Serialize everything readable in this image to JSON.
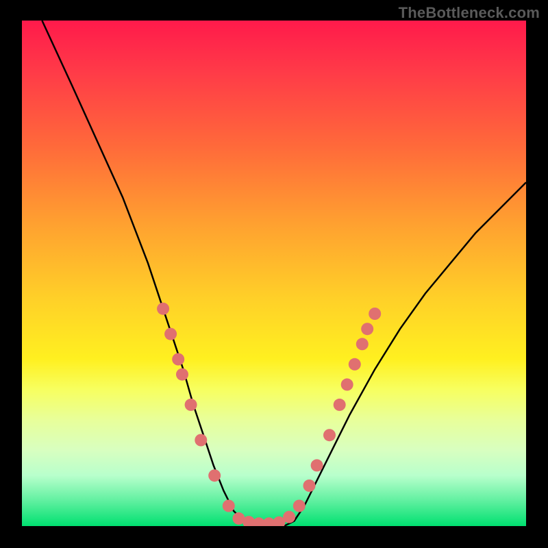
{
  "watermark": "TheBottleneck.com",
  "colors": {
    "background": "#000000",
    "curve": "#000000",
    "dots": "#e07070"
  },
  "chart_data": {
    "type": "line",
    "title": "",
    "xlabel": "",
    "ylabel": "",
    "xlim": [
      0,
      100
    ],
    "ylim": [
      0,
      100
    ],
    "grid": false,
    "legend": false,
    "note": "Values estimated from pixel positions; x is a normalized parameter axis (0–100), y is approximate 'fit/bottleneck' percentage where 0 = bottom (optimal) and 100 = top (worst).",
    "x": [
      4,
      10,
      15,
      20,
      25,
      28,
      30,
      32,
      34,
      36,
      38,
      40,
      42,
      44,
      46,
      48,
      50,
      52,
      54,
      56,
      60,
      65,
      70,
      75,
      80,
      85,
      90,
      95,
      100
    ],
    "y": [
      100,
      87,
      76,
      65,
      52,
      43,
      37,
      31,
      24,
      18,
      12,
      7,
      3,
      1,
      0,
      0,
      0,
      0,
      1,
      4,
      12,
      22,
      31,
      39,
      46,
      52,
      58,
      63,
      68
    ],
    "annotated_points": {
      "comment": "Salmon dots overlaid on the curve, mostly on the two limbs near the bottom.",
      "points": [
        {
          "x": 28,
          "y": 43
        },
        {
          "x": 29.5,
          "y": 38
        },
        {
          "x": 31,
          "y": 33
        },
        {
          "x": 31.8,
          "y": 30
        },
        {
          "x": 33.5,
          "y": 24
        },
        {
          "x": 35.5,
          "y": 17
        },
        {
          "x": 38.2,
          "y": 10
        },
        {
          "x": 41,
          "y": 4
        },
        {
          "x": 43,
          "y": 1.5
        },
        {
          "x": 45,
          "y": 0.8
        },
        {
          "x": 47,
          "y": 0.5
        },
        {
          "x": 49,
          "y": 0.5
        },
        {
          "x": 51,
          "y": 0.7
        },
        {
          "x": 53,
          "y": 1.8
        },
        {
          "x": 55,
          "y": 4
        },
        {
          "x": 57,
          "y": 8
        },
        {
          "x": 58.5,
          "y": 12
        },
        {
          "x": 61,
          "y": 18
        },
        {
          "x": 63,
          "y": 24
        },
        {
          "x": 64.5,
          "y": 28
        },
        {
          "x": 66,
          "y": 32
        },
        {
          "x": 67.5,
          "y": 36
        },
        {
          "x": 68.5,
          "y": 39
        },
        {
          "x": 70,
          "y": 42
        }
      ]
    }
  }
}
